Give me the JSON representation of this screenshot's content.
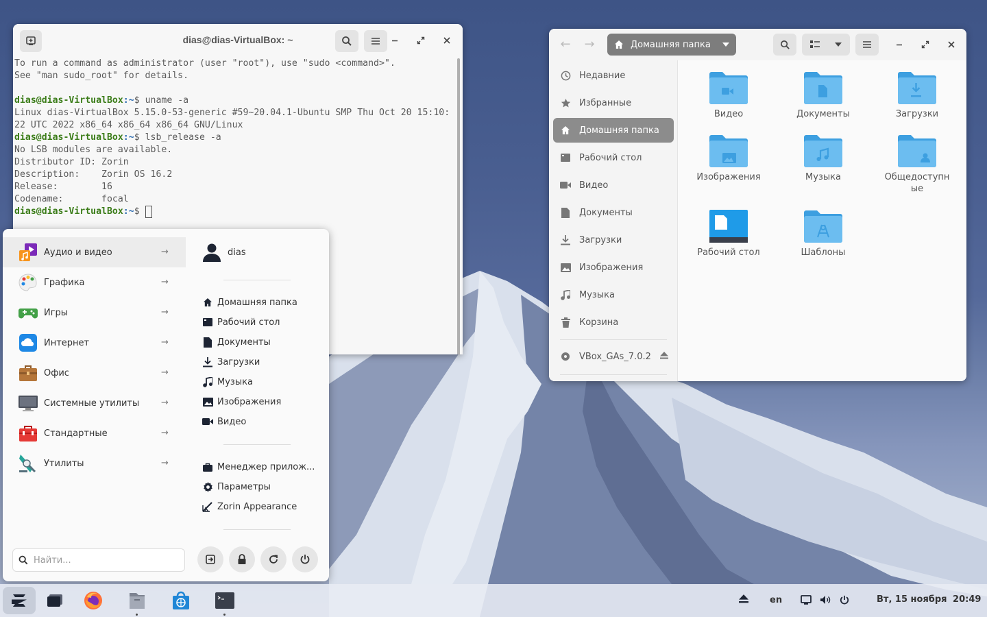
{
  "terminal": {
    "title": "dias@dias-VirtualBox: ~",
    "lines": [
      {
        "type": "text",
        "text": "To run a command as administrator (user \"root\"), use \"sudo <command>\"."
      },
      {
        "type": "text",
        "text": "See \"man sudo_root\" for details."
      },
      {
        "type": "text",
        "text": ""
      },
      {
        "type": "prompt",
        "user": "dias@dias-VirtualBox",
        "path": ":~",
        "cmd": "$ uname -a"
      },
      {
        "type": "text",
        "text": "Linux dias-VirtualBox 5.15.0-53-generic #59~20.04.1-Ubuntu SMP Thu Oct 20 15:10:"
      },
      {
        "type": "text",
        "text": "22 UTC 2022 x86_64 x86_64 x86_64 GNU/Linux"
      },
      {
        "type": "prompt",
        "user": "dias@dias-VirtualBox",
        "path": ":~",
        "cmd": "$ lsb_release -a"
      },
      {
        "type": "text",
        "text": "No LSB modules are available."
      },
      {
        "type": "text",
        "text": "Distributor ID:\tZorin"
      },
      {
        "type": "text",
        "text": "Description:\tZorin OS 16.2"
      },
      {
        "type": "text",
        "text": "Release:\t16"
      },
      {
        "type": "text",
        "text": "Codename:\tfocal"
      },
      {
        "type": "prompt_cursor",
        "user": "dias@dias-VirtualBox",
        "path": ":~",
        "cmd": "$ "
      }
    ]
  },
  "files": {
    "breadcrumb": "Домашняя папка",
    "sidebar": [
      {
        "label": "Недавние",
        "icon": "clock-icon"
      },
      {
        "label": "Избранные",
        "icon": "star-icon"
      },
      {
        "label": "Домашняя папка",
        "icon": "home-icon",
        "active": true
      },
      {
        "label": "Рабочий стол",
        "icon": "desktop-icon"
      },
      {
        "label": "Видео",
        "icon": "video-icon"
      },
      {
        "label": "Документы",
        "icon": "document-icon"
      },
      {
        "label": "Загрузки",
        "icon": "download-icon"
      },
      {
        "label": "Изображения",
        "icon": "image-icon"
      },
      {
        "label": "Музыка",
        "icon": "music-icon"
      },
      {
        "label": "Корзина",
        "icon": "trash-icon"
      }
    ],
    "device": {
      "label": "VBox_GAs_7.0.2",
      "icon": "disc-icon"
    },
    "folders": [
      {
        "label": "Видео",
        "icon": "video-folder-icon"
      },
      {
        "label": "Документы",
        "icon": "documents-folder-icon"
      },
      {
        "label": "Загрузки",
        "icon": "downloads-folder-icon"
      },
      {
        "label": "Изображения",
        "icon": "pictures-folder-icon"
      },
      {
        "label": "Музыка",
        "icon": "music-folder-icon"
      },
      {
        "label": "Общедоступные",
        "icon": "public-folder-icon"
      },
      {
        "label": "Рабочий стол",
        "icon": "desktop-folder-icon"
      },
      {
        "label": "Шаблоны",
        "icon": "templates-folder-icon"
      }
    ]
  },
  "menu": {
    "categories": [
      {
        "label": "Аудио и видео",
        "icon": "multimedia-icon",
        "active": true
      },
      {
        "label": "Графика",
        "icon": "graphics-palette-icon"
      },
      {
        "label": "Игры",
        "icon": "games-gamepad-icon"
      },
      {
        "label": "Интернет",
        "icon": "internet-cloud-icon"
      },
      {
        "label": "Офис",
        "icon": "office-briefcase-icon"
      },
      {
        "label": "Системные утилиты",
        "icon": "system-monitor-icon"
      },
      {
        "label": "Стандартные",
        "icon": "accessories-toolbox-icon"
      },
      {
        "label": "Утилиты",
        "icon": "utilities-icon"
      }
    ],
    "user": "dias",
    "places": [
      {
        "label": "Домашняя папка",
        "icon": "home-icon"
      },
      {
        "label": "Рабочий стол",
        "icon": "desktop-icon"
      },
      {
        "label": "Документы",
        "icon": "document-icon"
      },
      {
        "label": "Загрузки",
        "icon": "download-icon"
      },
      {
        "label": "Музыка",
        "icon": "music-icon"
      },
      {
        "label": "Изображения",
        "icon": "image-icon"
      },
      {
        "label": "Видео",
        "icon": "video-icon"
      }
    ],
    "system": [
      {
        "label": "Менеджер прилож...",
        "icon": "software-manager-icon"
      },
      {
        "label": "Параметры",
        "icon": "settings-gear-icon"
      },
      {
        "label": "Zorin Appearance",
        "icon": "appearance-brush-icon"
      }
    ],
    "search_placeholder": "Найти..."
  },
  "taskbar": {
    "keyboard_layout": "en",
    "date": "Вт, 15 ноября",
    "time": "20:49"
  },
  "colors": {
    "folder_blue": "#3d9fe0",
    "folder_light": "#6cbdf0",
    "accent_active": "#8c8c8c"
  }
}
